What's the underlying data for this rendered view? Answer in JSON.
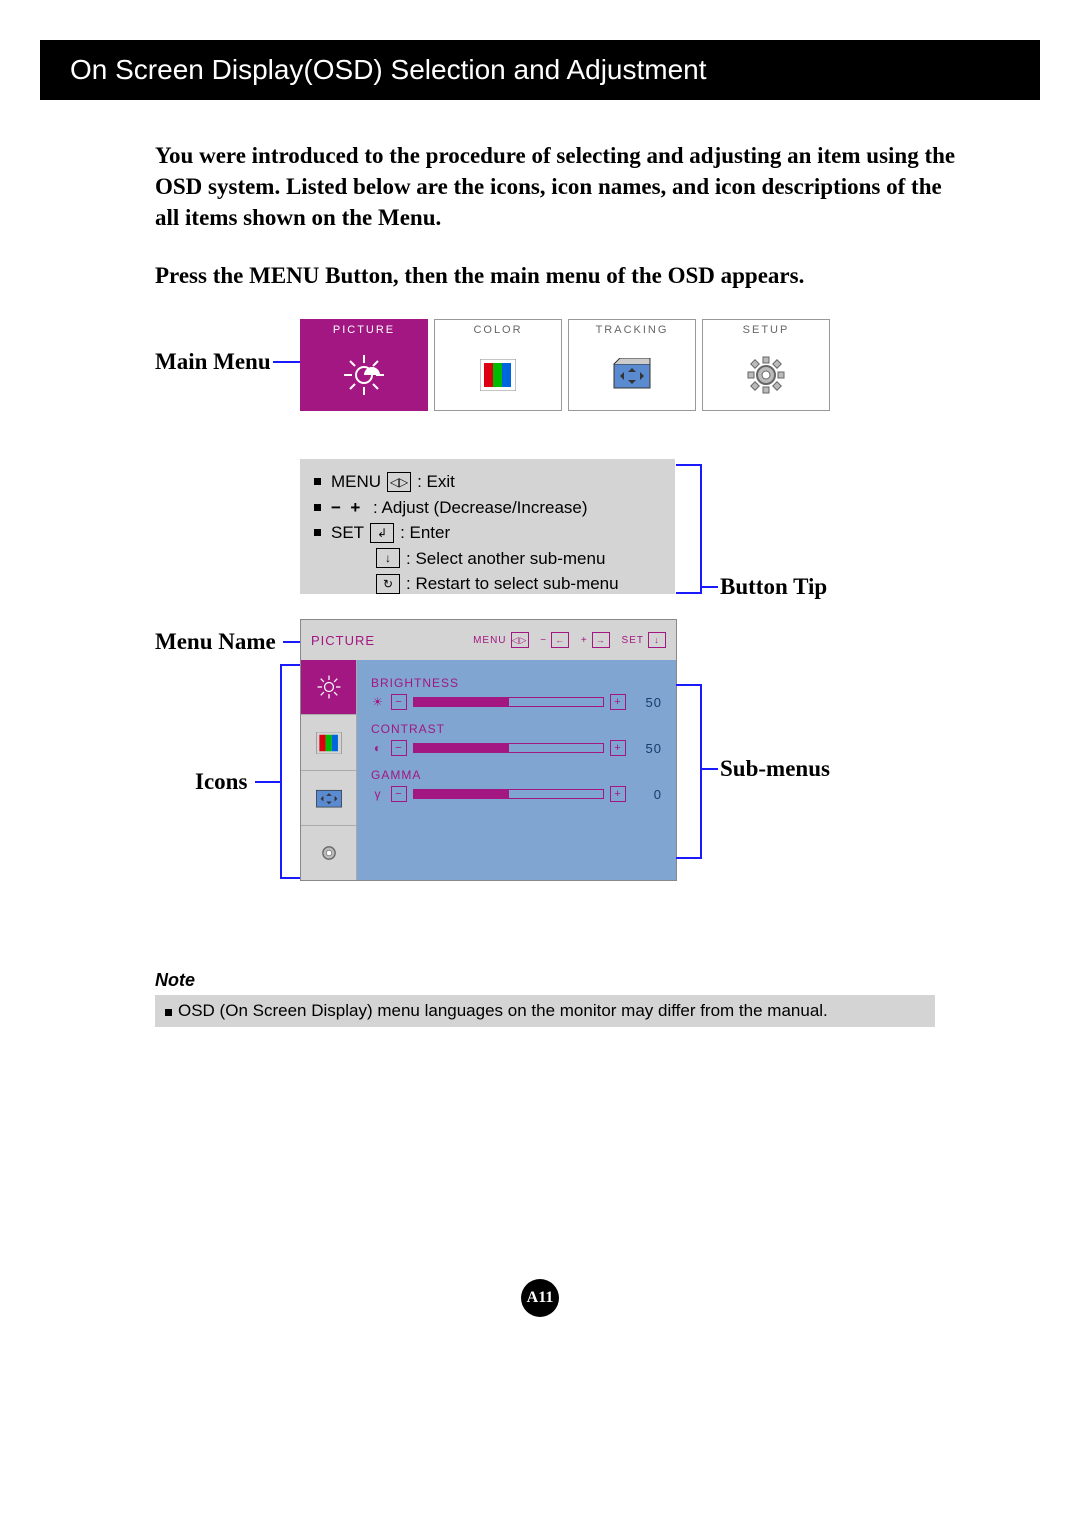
{
  "header": {
    "title": "On Screen Display(OSD) Selection and Adjustment"
  },
  "intro": "You were introduced to the procedure of selecting and adjusting an item using the OSD system.  Listed below are the icons, icon names, and icon descriptions of the all items shown on the Menu.",
  "instruction": "Press the MENU Button, then the main menu of the OSD appears.",
  "labels": {
    "main_menu": "Main Menu",
    "button_tip": "Button Tip",
    "menu_name": "Menu Name",
    "icons": "Icons",
    "sub_menus": "Sub-menus"
  },
  "tabs": [
    {
      "name": "PICTURE",
      "active": true
    },
    {
      "name": "COLOR",
      "active": false
    },
    {
      "name": "TRACKING",
      "active": false
    },
    {
      "name": "SETUP",
      "active": false
    }
  ],
  "tips": {
    "menu": "MENU",
    "menu_desc": ": Exit",
    "adjust_desc": ": Adjust (Decrease/Increase)",
    "set": "SET",
    "set_desc": ": Enter",
    "down_desc": ": Select another sub-menu",
    "restart_desc": ": Restart to select sub-menu"
  },
  "osd": {
    "title": "PICTURE",
    "hints": {
      "menu": "MENU",
      "minus": "−",
      "plus": "+",
      "set": "SET"
    },
    "subs": [
      {
        "name": "BRIGHTNESS",
        "symbol": "☀",
        "value": 50,
        "fill": 50
      },
      {
        "name": "CONTRAST",
        "symbol": "◐",
        "value": 50,
        "fill": 50
      },
      {
        "name": "GAMMA",
        "symbol": "γ",
        "value": 0,
        "fill": 50
      }
    ]
  },
  "note": {
    "heading": "Note",
    "text": "OSD (On Screen Display) menu languages on the monitor may differ from the manual."
  },
  "page_number": "A11"
}
